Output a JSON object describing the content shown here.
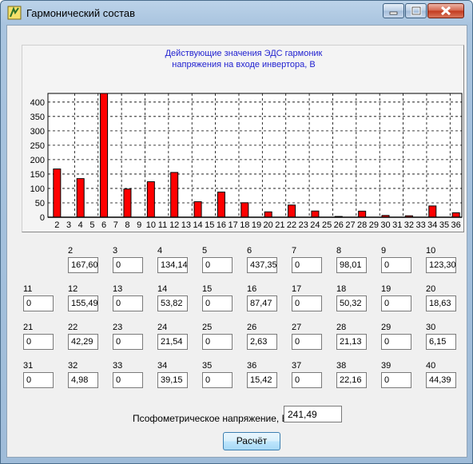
{
  "window": {
    "title": "Гармонический состав"
  },
  "chart_data": {
    "type": "bar",
    "title": "Действующие значения ЭДС гармоник напряжения на входе инвертора, В",
    "title_lines": [
      "Действующие значения ЭДС гармоник",
      "напряжения на входе инвертора, В"
    ],
    "categories": [
      "2",
      "3",
      "4",
      "5",
      "6",
      "7",
      "8",
      "9",
      "10",
      "11",
      "12",
      "13",
      "14",
      "15",
      "16",
      "17",
      "18",
      "19",
      "20",
      "21",
      "22",
      "23",
      "24",
      "25",
      "26",
      "27",
      "28",
      "29",
      "30",
      "31",
      "32",
      "33",
      "34",
      "35",
      "36"
    ],
    "values": [
      167.6,
      0,
      134.14,
      0,
      437.35,
      0,
      98.01,
      0,
      123.3,
      0,
      155.49,
      0,
      53.82,
      0,
      87.47,
      0,
      50.32,
      0,
      18.63,
      0,
      42.29,
      0,
      21.54,
      0,
      2.63,
      0,
      21.13,
      0,
      6.15,
      0,
      4.98,
      0,
      39.15,
      0,
      15.42
    ],
    "yticks": [
      0,
      50,
      100,
      150,
      200,
      250,
      300,
      350,
      400
    ],
    "ylim": [
      0,
      430
    ],
    "grid": true,
    "bar_color": "#ff0000",
    "legend": "none"
  },
  "harmonics": [
    {
      "n": "2",
      "v": "167,60"
    },
    {
      "n": "3",
      "v": "0"
    },
    {
      "n": "4",
      "v": "134,14"
    },
    {
      "n": "5",
      "v": "0"
    },
    {
      "n": "6",
      "v": "437,35"
    },
    {
      "n": "7",
      "v": "0"
    },
    {
      "n": "8",
      "v": "98,01"
    },
    {
      "n": "9",
      "v": "0"
    },
    {
      "n": "10",
      "v": "123,30"
    },
    {
      "n": "11",
      "v": "0"
    },
    {
      "n": "12",
      "v": "155,49"
    },
    {
      "n": "13",
      "v": "0"
    },
    {
      "n": "14",
      "v": "53,82"
    },
    {
      "n": "15",
      "v": "0"
    },
    {
      "n": "16",
      "v": "87,47"
    },
    {
      "n": "17",
      "v": "0"
    },
    {
      "n": "18",
      "v": "50,32"
    },
    {
      "n": "19",
      "v": "0"
    },
    {
      "n": "20",
      "v": "18,63"
    },
    {
      "n": "21",
      "v": "0"
    },
    {
      "n": "22",
      "v": "42,29"
    },
    {
      "n": "23",
      "v": "0"
    },
    {
      "n": "24",
      "v": "21,54"
    },
    {
      "n": "25",
      "v": "0"
    },
    {
      "n": "26",
      "v": "2,63"
    },
    {
      "n": "27",
      "v": "0"
    },
    {
      "n": "28",
      "v": "21,13"
    },
    {
      "n": "29",
      "v": "0"
    },
    {
      "n": "30",
      "v": "6,15"
    },
    {
      "n": "31",
      "v": "0"
    },
    {
      "n": "32",
      "v": "4,98"
    },
    {
      "n": "33",
      "v": "0"
    },
    {
      "n": "34",
      "v": "39,15"
    },
    {
      "n": "35",
      "v": "0"
    },
    {
      "n": "36",
      "v": "15,42"
    },
    {
      "n": "37",
      "v": "0"
    },
    {
      "n": "38",
      "v": "22,16"
    },
    {
      "n": "39",
      "v": "0"
    },
    {
      "n": "40",
      "v": "44,39"
    }
  ],
  "psophometric": {
    "label": "Псофометрическое напряжение, В",
    "value": "241,49"
  },
  "calc_button": {
    "label": "Расчёт"
  }
}
